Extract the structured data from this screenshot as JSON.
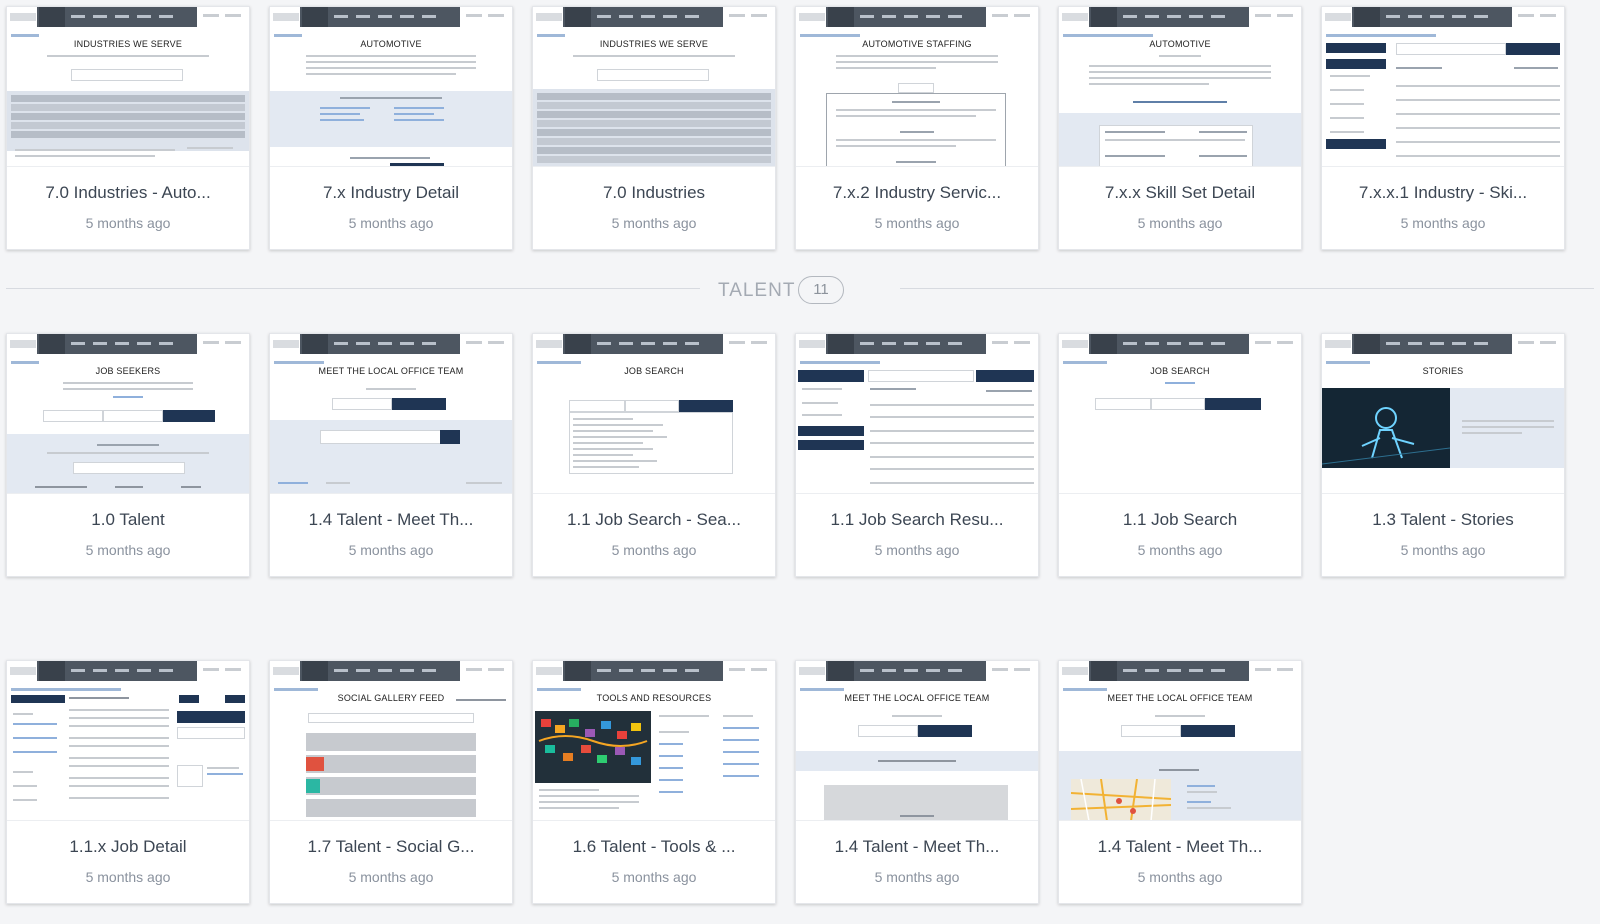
{
  "section": {
    "label": "TALENT",
    "count": "11"
  },
  "rows": [
    {
      "cards": [
        {
          "title": "7.0 Industries - Auto...",
          "time": "5 months ago",
          "thumb_heading": "INDUSTRIES WE SERVE"
        },
        {
          "title": "7.x Industry Detail",
          "time": "5 months ago",
          "thumb_heading": "AUTOMOTIVE"
        },
        {
          "title": "7.0 Industries",
          "time": "5 months ago",
          "thumb_heading": "INDUSTRIES WE SERVE"
        },
        {
          "title": "7.x.2 Industry Servic...",
          "time": "5 months ago",
          "thumb_heading": "AUTOMOTIVE STAFFING"
        },
        {
          "title": "7.x.x Skill Set Detail",
          "time": "5 months ago",
          "thumb_heading": "AUTOMOTIVE"
        },
        {
          "title": "7.x.x.1 Industry - Ski...",
          "time": "5 months ago",
          "thumb_heading": ""
        }
      ]
    },
    {
      "cards": [
        {
          "title": "1.0 Talent",
          "time": "5 months ago",
          "thumb_heading": "JOB SEEKERS"
        },
        {
          "title": "1.4 Talent - Meet Th...",
          "time": "5 months ago",
          "thumb_heading": "MEET THE LOCAL OFFICE TEAM"
        },
        {
          "title": "1.1 Job Search - Sea...",
          "time": "5 months ago",
          "thumb_heading": "JOB SEARCH"
        },
        {
          "title": "1.1 Job Search Resu...",
          "time": "5 months ago",
          "thumb_heading": ""
        },
        {
          "title": "1.1 Job Search",
          "time": "5 months ago",
          "thumb_heading": "JOB SEARCH"
        },
        {
          "title": "1.3 Talent - Stories",
          "time": "5 months ago",
          "thumb_heading": "STORIES"
        }
      ]
    },
    {
      "cards": [
        {
          "title": "1.1.x Job Detail",
          "time": "5 months ago",
          "thumb_heading": ""
        },
        {
          "title": "1.7 Talent - Social G...",
          "time": "5 months ago",
          "thumb_heading": "SOCIAL GALLERY FEED"
        },
        {
          "title": "1.6 Talent - Tools & ...",
          "time": "5 months ago",
          "thumb_heading": "TOOLS AND RESOURCES"
        },
        {
          "title": "1.4 Talent - Meet Th...",
          "time": "5 months ago",
          "thumb_heading": "MEET THE LOCAL OFFICE TEAM"
        },
        {
          "title": "1.4 Talent - Meet Th...",
          "time": "5 months ago",
          "thumb_heading": "MEET THE LOCAL OFFICE TEAM"
        }
      ]
    }
  ]
}
